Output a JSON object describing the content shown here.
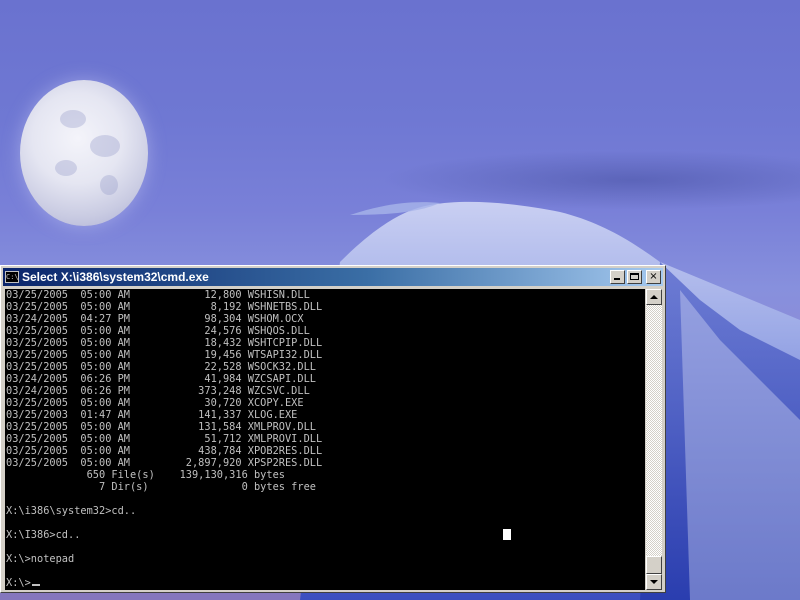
{
  "window": {
    "title": "Select X:\\i386\\system32\\cmd.exe",
    "icon_label": "C:\\",
    "icon": "console-icon",
    "buttons": {
      "minimize": "minimize-icon",
      "maximize": "maximize-icon",
      "close": "×"
    }
  },
  "console": {
    "lines": [
      "03/25/2005  05:00 AM            12,800 WSHISN.DLL",
      "03/25/2005  05:00 AM             8,192 WSHNETBS.DLL",
      "03/24/2005  04:27 PM            98,304 WSHOM.OCX",
      "03/25/2005  05:00 AM            24,576 WSHQOS.DLL",
      "03/25/2005  05:00 AM            18,432 WSHTCPIP.DLL",
      "03/25/2005  05:00 AM            19,456 WTSAPI32.DLL",
      "03/25/2005  05:00 AM            22,528 WSOCK32.DLL",
      "03/24/2005  06:26 PM            41,984 WZCSAPI.DLL",
      "03/24/2005  06:26 PM           373,248 WZCSVC.DLL",
      "03/25/2005  05:00 AM            30,720 XCOPY.EXE",
      "03/25/2003  01:47 AM           141,337 XLOG.EXE",
      "03/25/2005  05:00 AM           131,584 XMLPROV.DLL",
      "03/25/2005  05:00 AM            51,712 XMLPROVI.DLL",
      "03/25/2005  05:00 AM           438,784 XPOB2RES.DLL",
      "03/25/2005  05:00 AM         2,897,920 XPSP2RES.DLL",
      "             650 File(s)    139,130,316 bytes",
      "               7 Dir(s)               0 bytes free",
      "",
      "X:\\i386\\system32>cd..",
      "",
      "X:\\I386>cd..",
      "",
      "X:\\>notepad",
      ""
    ],
    "prompt": "X:\\>"
  },
  "colors": {
    "console_bg": "#000000",
    "console_text": "#c0c0c0",
    "titlebar_start": "#0a246a",
    "titlebar_end": "#a6caf0",
    "window_face": "#d4d0c8"
  }
}
